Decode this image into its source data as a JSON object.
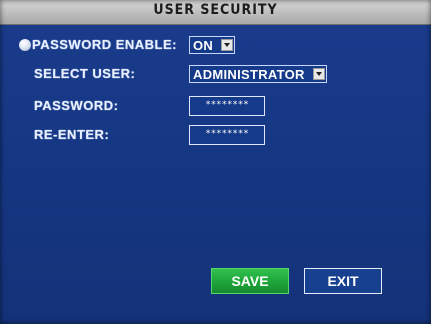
{
  "window": {
    "title": "USER SECURITY"
  },
  "form": {
    "password_enable": {
      "label": "PASSWORD ENABLE:",
      "value": "ON"
    },
    "select_user": {
      "label": "SELECT USER:",
      "value": "ADMINISTRATOR"
    },
    "password": {
      "label": "PASSWORD:",
      "value": "********"
    },
    "re_enter": {
      "label": "RE-ENTER:",
      "value": "********"
    }
  },
  "buttons": {
    "save": "SAVE",
    "exit": "EXIT"
  },
  "colors": {
    "background": "#1a3c8c",
    "title_bar": "#c4c4c4",
    "save_button": "#22aa3f",
    "text": "#e8f0ff"
  }
}
